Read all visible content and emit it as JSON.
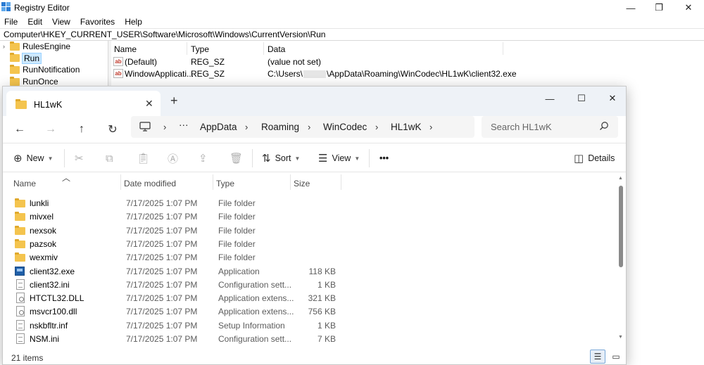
{
  "registry": {
    "title": "Registry Editor",
    "menu": [
      "File",
      "Edit",
      "View",
      "Favorites",
      "Help"
    ],
    "address": "Computer\\HKEY_CURRENT_USER\\Software\\Microsoft\\Windows\\CurrentVersion\\Run",
    "tree": [
      "RulesEngine",
      "Run",
      "RunNotification",
      "RunOnce"
    ],
    "selected_tree_item": "Run",
    "columns": [
      "Name",
      "Type",
      "Data"
    ],
    "values": [
      {
        "name": "(Default)",
        "type": "REG_SZ",
        "data": "(value not set)"
      },
      {
        "name": "WindowApplicati...",
        "type": "REG_SZ",
        "data_prefix": "C:\\Users\\",
        "data_suffix": "\\AppData\\Roaming\\WinCodec\\HL1wK\\client32.exe"
      }
    ]
  },
  "explorer": {
    "tab_title": "HL1wK",
    "breadcrumb": [
      "AppData",
      "Roaming",
      "WinCodec",
      "HL1wK"
    ],
    "search_placeholder": "Search HL1wK",
    "toolbar": {
      "new_label": "New",
      "sort_label": "Sort",
      "view_label": "View",
      "more_label": "•••",
      "details_label": "Details"
    },
    "columns": {
      "name": "Name",
      "date": "Date modified",
      "type": "Type",
      "size": "Size"
    },
    "files": [
      {
        "name": "lunkli",
        "date": "7/17/2025 1:07 PM",
        "type": "File folder",
        "size": "",
        "icon": "folder"
      },
      {
        "name": "mivxel",
        "date": "7/17/2025 1:07 PM",
        "type": "File folder",
        "size": "",
        "icon": "folder"
      },
      {
        "name": "nexsok",
        "date": "7/17/2025 1:07 PM",
        "type": "File folder",
        "size": "",
        "icon": "folder"
      },
      {
        "name": "pazsok",
        "date": "7/17/2025 1:07 PM",
        "type": "File folder",
        "size": "",
        "icon": "folder"
      },
      {
        "name": "wexmiv",
        "date": "7/17/2025 1:07 PM",
        "type": "File folder",
        "size": "",
        "icon": "folder"
      },
      {
        "name": "client32.exe",
        "date": "7/17/2025 1:07 PM",
        "type": "Application",
        "size": "118 KB",
        "icon": "exe"
      },
      {
        "name": "client32.ini",
        "date": "7/17/2025 1:07 PM",
        "type": "Configuration sett...",
        "size": "1 KB",
        "icon": "doc"
      },
      {
        "name": "HTCTL32.DLL",
        "date": "7/17/2025 1:07 PM",
        "type": "Application extens...",
        "size": "321 KB",
        "icon": "dll"
      },
      {
        "name": "msvcr100.dll",
        "date": "7/17/2025 1:07 PM",
        "type": "Application extens...",
        "size": "756 KB",
        "icon": "dll"
      },
      {
        "name": "nskbfltr.inf",
        "date": "7/17/2025 1:07 PM",
        "type": "Setup Information",
        "size": "1 KB",
        "icon": "doc"
      },
      {
        "name": "NSM.ini",
        "date": "7/17/2025 1:07 PM",
        "type": "Configuration sett...",
        "size": "7 KB",
        "icon": "doc"
      }
    ],
    "status": "21 items"
  },
  "colors": {
    "folder": "#f4c44e",
    "selection": "#cce8ff",
    "tabbar": "#eef2f7"
  }
}
